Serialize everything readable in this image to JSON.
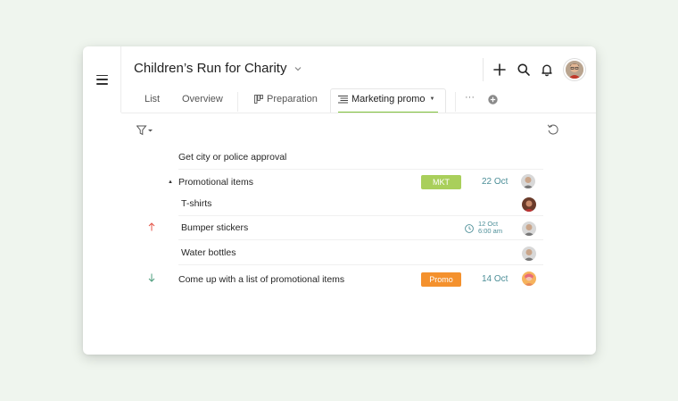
{
  "project": {
    "title": "Children’s Run for Charity"
  },
  "tabs": [
    {
      "label": "List"
    },
    {
      "label": "Overview"
    },
    {
      "label": "Preparation"
    },
    {
      "label": "Marketing promo"
    }
  ],
  "more_label": "···",
  "tasks": [
    {
      "label": "Get city or police approval"
    },
    {
      "label": "Promotional items",
      "tag": "MKT",
      "date": "22 Oct"
    },
    {
      "label": "T-shirts"
    },
    {
      "label": "Bumper stickers",
      "due_date": "12 Oct",
      "due_time": "6:00 am"
    },
    {
      "label": "Water bottles"
    },
    {
      "label": "Come up with a list of promotional items",
      "tag": "Promo",
      "date": "14 Oct"
    }
  ],
  "colors": {
    "accent_green": "#7fc23a",
    "tag_mkt": "#a9cf5b",
    "tag_promo": "#f4912d",
    "date_text": "#4d8f98",
    "arrow_up": "#e4574a",
    "arrow_down": "#4c9c7c"
  },
  "icons": [
    "menu-icon",
    "chevron-down-icon",
    "plus-icon",
    "search-icon",
    "bell-icon",
    "board-icon",
    "list-icon",
    "add-tab-icon",
    "filter-icon",
    "refresh-icon",
    "clock-icon",
    "arrow-up-icon",
    "arrow-down-icon"
  ]
}
